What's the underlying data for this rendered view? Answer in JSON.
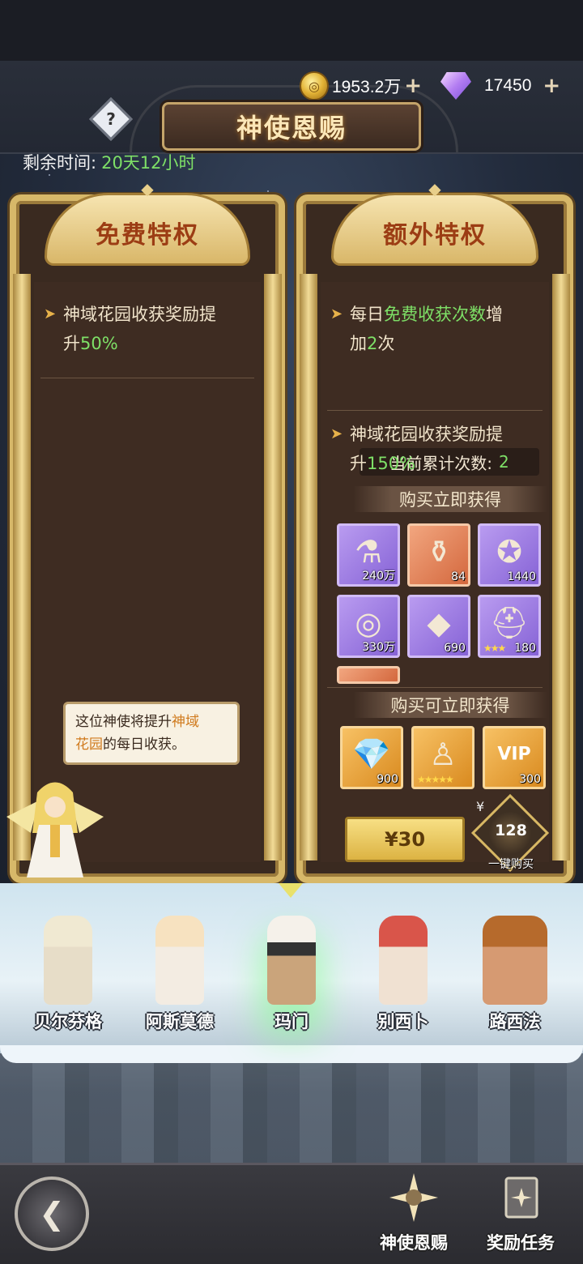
{
  "header": {
    "title": "神使恩赐",
    "help_icon": "question-icon",
    "remaining_label": "剩余时间:",
    "remaining_value": "20天12小时",
    "gold": "1953.2万",
    "gems": "17450",
    "plus": "+"
  },
  "free_panel": {
    "title": "免费特权",
    "bullet_text": "神域花园收获奖励提",
    "bullet_text2": "升",
    "bullet_value": "50%"
  },
  "extra_panel": {
    "title": "额外特权",
    "bullet1_a": "每日",
    "bullet1_hl": "免费收获次数",
    "bullet1_b": "增",
    "bullet1_c": "加",
    "bullet1_val": "2",
    "bullet1_d": "次",
    "count_label": "当前累计次数:",
    "count_value": "2",
    "bullet2_text": "神域花园收获奖励提",
    "bullet2_text2": "升",
    "bullet2_value": "150%",
    "section1": "购买立即获得",
    "items1": [
      {
        "icon": "purple-potion-icon",
        "qty": "240万"
      },
      {
        "icon": "blue-potion-icon",
        "qty": "84"
      },
      {
        "icon": "star-medal-icon",
        "qty": "1440"
      },
      {
        "icon": "gold-coin-icon",
        "qty": "330万"
      },
      {
        "icon": "blue-crystal-icon",
        "qty": "690"
      },
      {
        "icon": "purple-helmet-icon",
        "qty": "180"
      }
    ],
    "section2": "购买可立即获得",
    "items2": [
      {
        "icon": "diamond-icon",
        "qty": "900"
      },
      {
        "icon": "hero-summon-icon",
        "qty": ""
      },
      {
        "icon": "vip-badge-icon",
        "qty": "300"
      }
    ],
    "buy_label": "¥30",
    "onekey_yen": "¥",
    "onekey_price": "128",
    "onekey_label": "一键购买"
  },
  "bubble": {
    "a": "这位神使将提升",
    "hl": "神域",
    "hl2": "花园",
    "b": "的每日收获。"
  },
  "heroes": [
    "贝尔芬格",
    "阿斯莫德",
    "玛门",
    "别西卜",
    "路西法"
  ],
  "nav": {
    "back_icon": "back-arrow-icon",
    "item1": "神使恩赐",
    "item2": "奖励任务"
  },
  "colors": {
    "highlight_green": "#7ee067",
    "panel_gold": "#d7b869",
    "title_red": "#9c3d14"
  }
}
